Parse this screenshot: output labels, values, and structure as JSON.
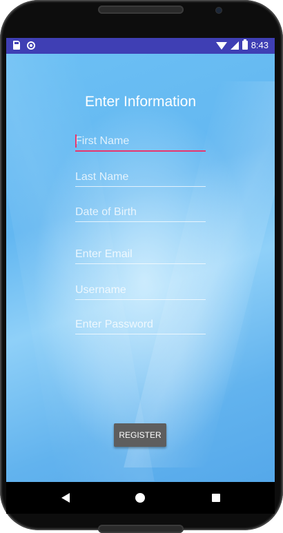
{
  "status_bar": {
    "time": "8:43",
    "icons": [
      "sd-card-icon",
      "sync-icon",
      "wifi-icon",
      "signal-icon",
      "battery-icon"
    ]
  },
  "form": {
    "title": "Enter Information",
    "fields": [
      {
        "name": "first-name-input",
        "placeholder": "First Name",
        "value": "",
        "focused": true
      },
      {
        "name": "last-name-input",
        "placeholder": "Last Name",
        "value": ""
      },
      {
        "name": "dob-input",
        "placeholder": "Date of Birth",
        "value": ""
      },
      {
        "name": "email-input",
        "placeholder": "Enter Email",
        "value": ""
      },
      {
        "name": "username-input",
        "placeholder": "Username",
        "value": ""
      },
      {
        "name": "password-input",
        "placeholder": "Enter Password",
        "value": ""
      }
    ],
    "register_label": "REGISTER"
  },
  "nav_bar": {
    "icons": [
      "back-icon",
      "home-icon",
      "recents-icon"
    ]
  },
  "colors": {
    "status_bar": "#3f3fb4",
    "background": "#5bb3ef",
    "accent": "#e8356d",
    "button": "#5e5e5e"
  }
}
